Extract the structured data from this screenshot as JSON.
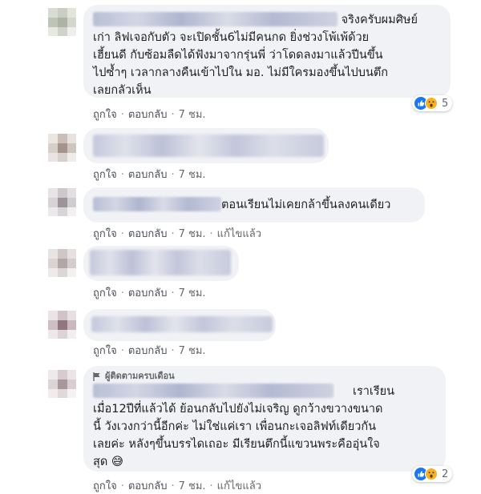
{
  "actions": {
    "like": "ถูกใจ",
    "reply": "ตอบกลับ",
    "time": "7 ชม.",
    "edited": "แก้ไขแล้ว"
  },
  "comments": [
    {
      "text_lines": [
        "จริงครับผมศิษย์",
        "เก่า ลิฟเจอกับตัว จะเปิดชั้น6ไม่มีคนกด ยิ่งช่วงโพ้เพ้ด้วย",
        "เฮี้ยนดี กับซ้อมลืดได้ฟังมาจากรุ่นพี่ ว่าโดดลงมาแล้วปีนขึ้น",
        "ไปซ้ำๆ เวลากลางคืนเข้าไปใน มอ. ไม่มีใครมองขึ้นไปบนตึก",
        "เลยกลัวเห็น"
      ],
      "reactions": {
        "count": "5",
        "icons": [
          "like-icon",
          "wow-icon"
        ]
      }
    },
    {
      "text": ""
    },
    {
      "text": "ตอนเรียนไม่เคยกล้าขึ้นลงคนเดียว",
      "edited": true
    },
    {
      "text": ""
    },
    {
      "text": ""
    },
    {
      "badge": "ผู้ติดตามครบเดือน",
      "text_lines": [
        "เราเรียน",
        "เมื่อ12ปีที่แล้วได้ ย้อนกลับไปยังไม่เจริญ ดูกว้างขวางขนาด",
        "นี้ วังเวงกว่านี้อีกค่ะ ไม่ใช่แค่เรา เพื่อนกะเจอลิฟท์เดียวกัน",
        "เลยค่ะ หลังๆขึ้นบรรไดเถอะ มีเรียนตึกนี้แขวนพระคืออุ่นใจ",
        "สุด"
      ],
      "emoji": "😅",
      "edited": true,
      "reactions": {
        "count": "2",
        "icons": [
          "like-icon",
          "wow-icon"
        ]
      }
    }
  ]
}
